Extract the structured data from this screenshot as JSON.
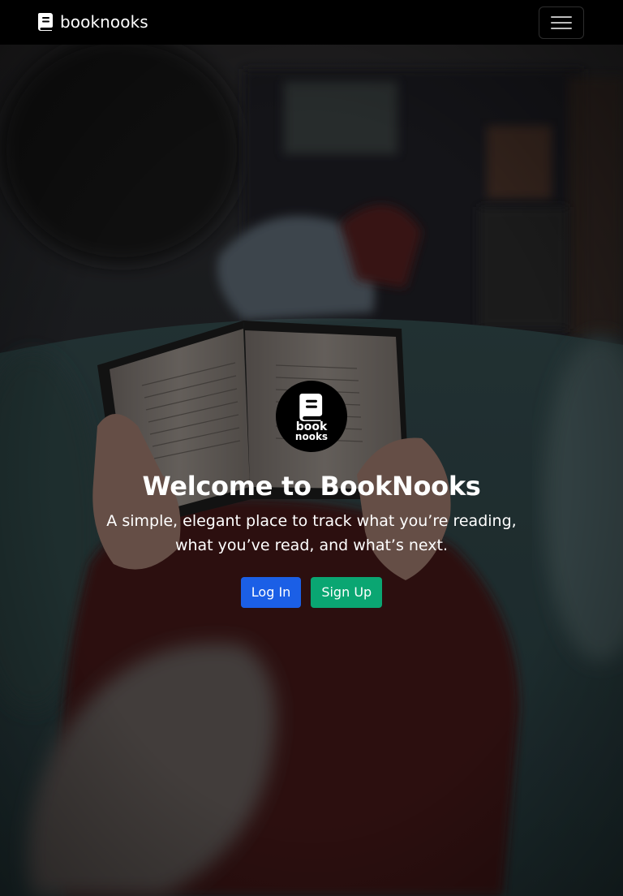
{
  "navbar": {
    "brand_text": "booknooks",
    "brand_icon": "book-icon",
    "menu_icon": "hamburger-menu-icon",
    "background": "#000000"
  },
  "hero": {
    "logo": {
      "line1": "book",
      "line2": "nooks"
    },
    "title": "Welcome to BookNooks",
    "subtitle": "A simple, elegant place to track what you’re reading, what you’ve read, and what’s next.",
    "buttons": {
      "login_label": "Log In",
      "signup_label": "Sign Up"
    }
  },
  "colors": {
    "login_button": "#1b5fe6",
    "signup_button": "#0aa672",
    "text": "#ffffff"
  }
}
